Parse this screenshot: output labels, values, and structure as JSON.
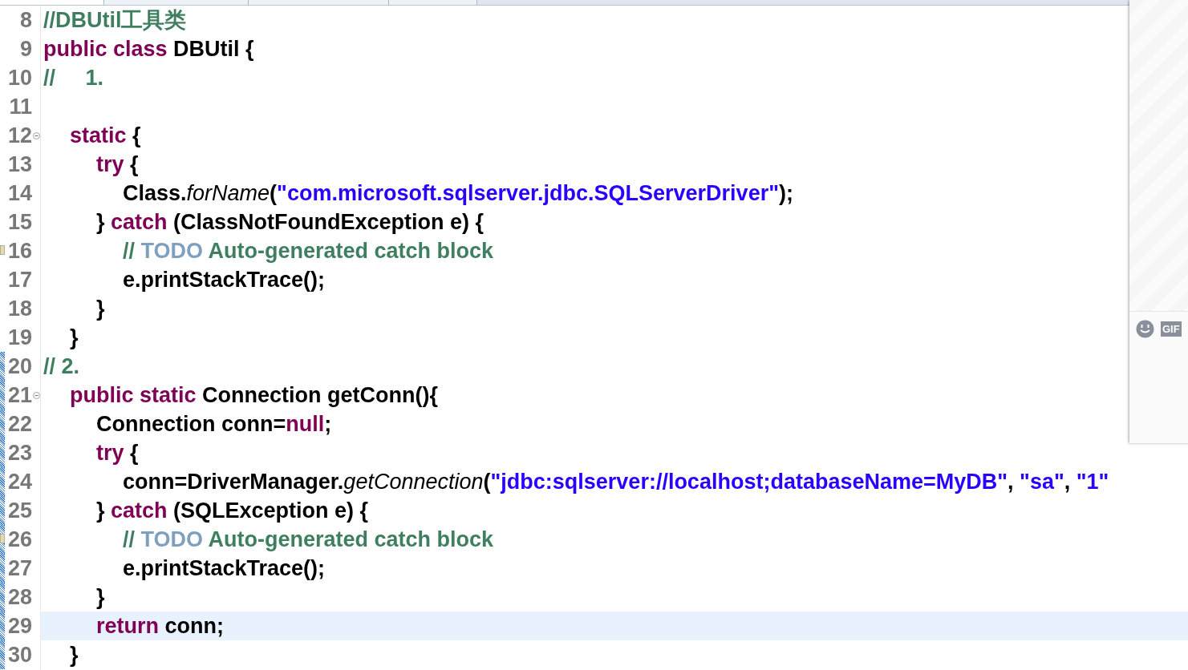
{
  "editor_tabs": [
    {
      "selected": true
    },
    {
      "selected": false
    },
    {
      "selected": false
    },
    {
      "selected": false
    }
  ],
  "lines": [
    {
      "number": "8",
      "tokens": [
        {
          "kind": "comment",
          "text": "//DBUtil工具类"
        }
      ]
    },
    {
      "number": "9",
      "tokens": [
        {
          "kind": "keyword",
          "text": "public class"
        },
        {
          "kind": "plain",
          "text": " DBUtil {"
        }
      ]
    },
    {
      "number": "10",
      "tokens": [
        {
          "kind": "comment",
          "text": "//     1."
        }
      ]
    },
    {
      "number": "11",
      "children": [
        {
          "number": "12",
          "fold": true,
          "tokens": [
            {
              "kind": "keyword",
              "text": "static"
            },
            {
              "kind": "plain",
              "text": " {"
            }
          ],
          "children": [
            {
              "number": "13",
              "tokens": [
                {
                  "kind": "keyword",
                  "text": "try"
                },
                {
                  "kind": "plain",
                  "text": " {"
                }
              ],
              "children": [
                {
                  "number": "14",
                  "tokens": [
                    {
                      "kind": "plain",
                      "text": "Class."
                    },
                    {
                      "kind": "method",
                      "text": "forName"
                    },
                    {
                      "kind": "plain",
                      "text": "("
                    },
                    {
                      "kind": "string",
                      "text": "\"com.microsoft.sqlserver.jdbc.SQLServerDriver\""
                    },
                    {
                      "kind": "plain",
                      "text": ");"
                    }
                  ]
                }
              ]
            },
            {
              "number": "15",
              "tokens": [
                {
                  "kind": "plain",
                  "text": "} "
                },
                {
                  "kind": "keyword",
                  "text": "catch"
                },
                {
                  "kind": "plain",
                  "text": " (ClassNotFoundException e) {"
                }
              ],
              "children": [
                {
                  "number": "16",
                  "task_marker": true,
                  "tokens": [
                    {
                      "kind": "comment",
                      "text": "// "
                    },
                    {
                      "kind": "task",
                      "text": "TODO"
                    },
                    {
                      "kind": "comment",
                      "text": " Auto-generated catch block"
                    }
                  ]
                },
                {
                  "number": "17",
                  "tokens": [
                    {
                      "kind": "plain",
                      "text": "e.printStackTrace();"
                    }
                  ]
                }
              ]
            },
            {
              "number": "18",
              "tokens": [
                {
                  "kind": "plain",
                  "text": "}"
                }
              ]
            }
          ]
        },
        {
          "number": "19",
          "tokens": [
            {
              "kind": "plain",
              "text": "}"
            }
          ]
        }
      ]
    },
    {
      "number": "20",
      "range": true,
      "tokens": [
        {
          "kind": "comment",
          "text": "// 2."
        }
      ],
      "children": [
        {
          "number": "21",
          "range": true,
          "fold": true,
          "tokens": [
            {
              "kind": "keyword",
              "text": "public static"
            },
            {
              "kind": "plain",
              "text": " Connection getConn(){"
            }
          ],
          "children": [
            {
              "number": "22",
              "range": true,
              "tokens": [
                {
                  "kind": "plain",
                  "text": "Connection conn="
                },
                {
                  "kind": "keyword",
                  "text": "null"
                },
                {
                  "kind": "plain",
                  "text": ";"
                }
              ]
            },
            {
              "number": "23",
              "range": true,
              "tokens": [
                {
                  "kind": "keyword",
                  "text": "try"
                },
                {
                  "kind": "plain",
                  "text": " {"
                }
              ],
              "children": [
                {
                  "number": "24",
                  "range": true,
                  "tokens": [
                    {
                      "kind": "plain",
                      "text": "conn=DriverManager."
                    },
                    {
                      "kind": "method",
                      "text": "getConnection"
                    },
                    {
                      "kind": "plain",
                      "text": "("
                    },
                    {
                      "kind": "string",
                      "text": "\"jdbc:sqlserver://localhost;databaseName=MyDB\""
                    },
                    {
                      "kind": "plain",
                      "text": ", "
                    },
                    {
                      "kind": "string",
                      "text": "\"sa\""
                    },
                    {
                      "kind": "plain",
                      "text": ", "
                    },
                    {
                      "kind": "string",
                      "text": "\"1\""
                    }
                  ]
                }
              ]
            },
            {
              "number": "25",
              "range": true,
              "tokens": [
                {
                  "kind": "plain",
                  "text": "} "
                },
                {
                  "kind": "keyword",
                  "text": "catch"
                },
                {
                  "kind": "plain",
                  "text": " (SQLException e) {"
                }
              ],
              "children": [
                {
                  "number": "26",
                  "range": true,
                  "task_marker": true,
                  "tokens": [
                    {
                      "kind": "comment",
                      "text": "// "
                    },
                    {
                      "kind": "task",
                      "text": "TODO"
                    },
                    {
                      "kind": "comment",
                      "text": " Auto-generated catch block"
                    }
                  ]
                },
                {
                  "number": "27",
                  "range": true,
                  "tokens": [
                    {
                      "kind": "plain",
                      "text": "e.printStackTrace();"
                    }
                  ]
                }
              ]
            },
            {
              "number": "28",
              "range": true,
              "tokens": [
                {
                  "kind": "plain",
                  "text": "}"
                }
              ]
            },
            {
              "number": "29",
              "range": true,
              "current": true,
              "tokens": [
                {
                  "kind": "keyword",
                  "text": "return"
                },
                {
                  "kind": "plain",
                  "text": " conn;"
                }
              ]
            }
          ]
        },
        {
          "number": "30",
          "range": true,
          "tokens": [
            {
              "kind": "plain",
              "text": "}"
            }
          ]
        }
      ]
    }
  ],
  "chat_panel": {
    "gif_label": "GIF"
  }
}
